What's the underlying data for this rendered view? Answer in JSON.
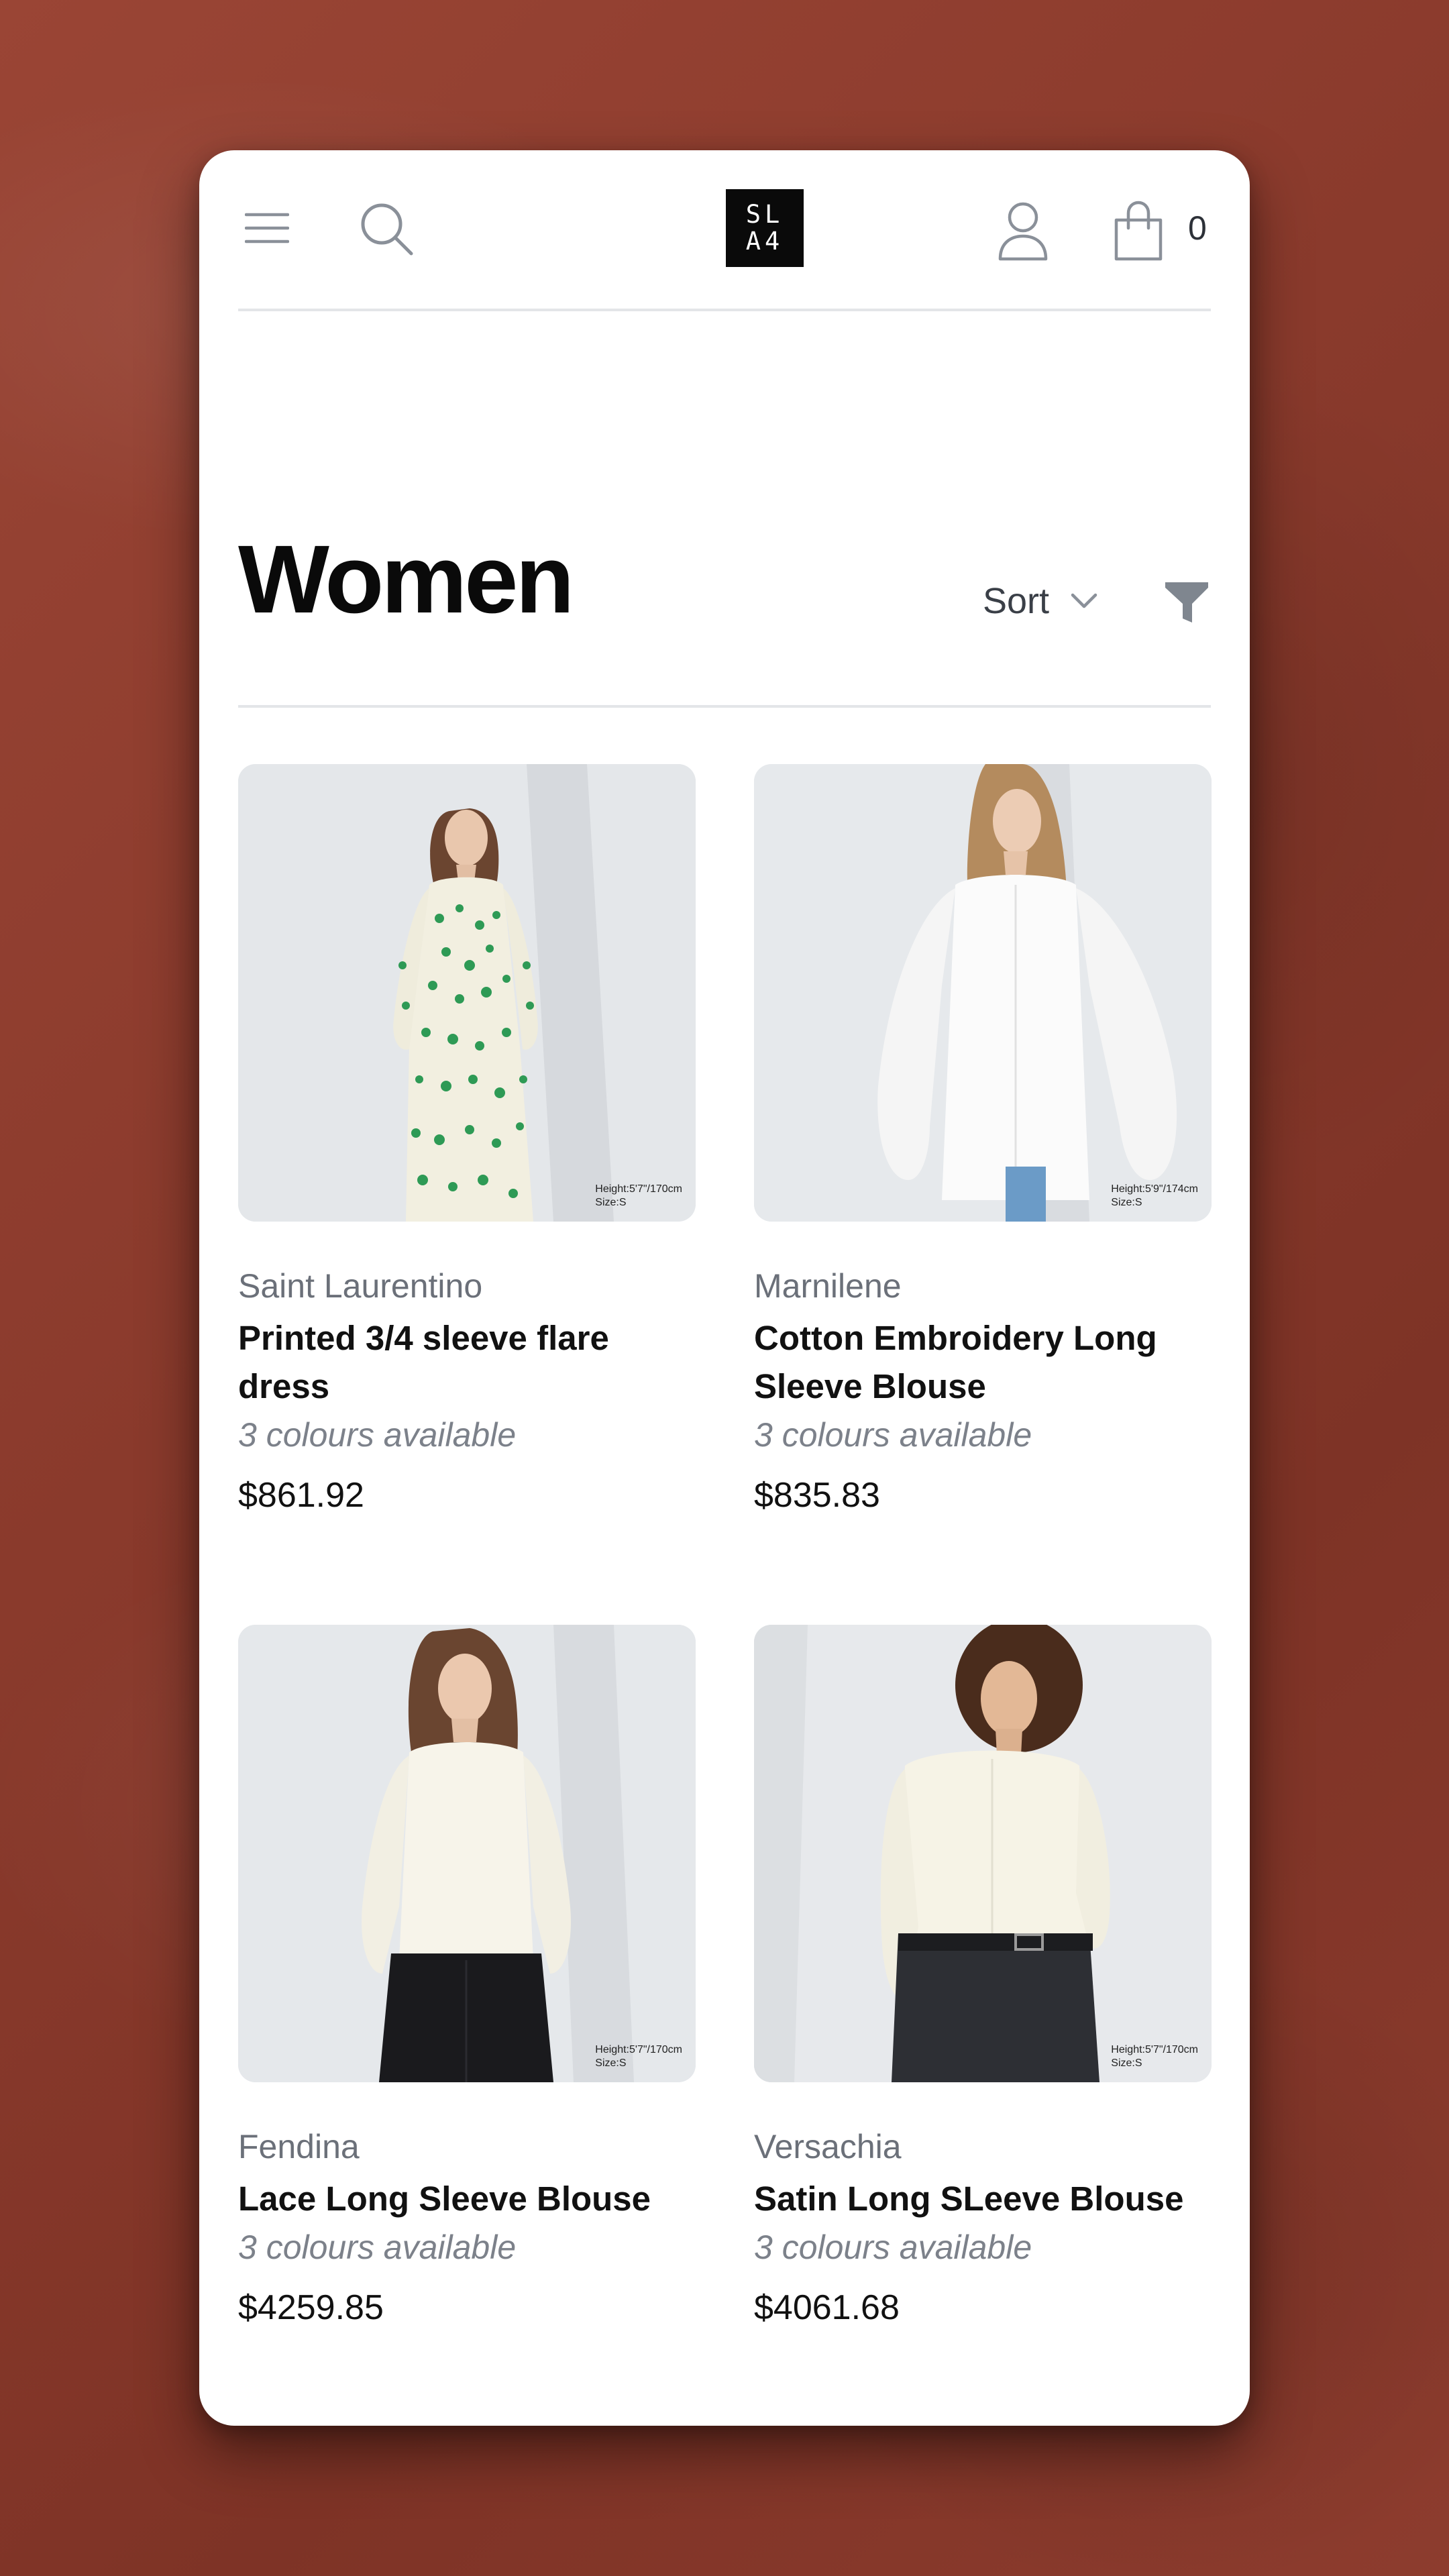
{
  "header": {
    "logo_text": "SL\nA4",
    "cart_count": "0",
    "icons": [
      "menu-icon",
      "search-icon",
      "user-icon",
      "shopping-bag-icon"
    ]
  },
  "page": {
    "title": "Women",
    "sort_label": "Sort",
    "icons": [
      "chevron-down-icon",
      "filter-icon"
    ]
  },
  "products": [
    {
      "brand": "Saint Laurentino",
      "name": "Printed 3/4 sleeve flare dress",
      "colours": "3 colours available",
      "price": "$861.92",
      "size_note_1": "Height:5'7\"/170cm",
      "size_note_2": "Size:S"
    },
    {
      "brand": "Marnilene",
      "name": "Cotton Embroidery Long Sleeve Blouse",
      "colours": "3 colours available",
      "price": "$835.83",
      "size_note_1": "Height:5'9\"/174cm",
      "size_note_2": "Size:S"
    },
    {
      "brand": "Fendina",
      "name": "Lace Long Sleeve Blouse",
      "colours": "3 colours available",
      "price": "$4259.85",
      "size_note_1": "Height:5'7\"/170cm",
      "size_note_2": "Size:S"
    },
    {
      "brand": "Versachia",
      "name": "Satin Long SLeeve Blouse",
      "colours": "3 colours available",
      "price": "$4061.68",
      "size_note_1": "Height:5'7\"/170cm",
      "size_note_2": "Size:S"
    }
  ],
  "colors": {
    "background": "#8a3a2c",
    "card": "#ffffff",
    "title": "#0a0a0a",
    "brand_text": "#6b7079",
    "muted_italic": "#7c818a",
    "icon_stroke": "#8a9099",
    "divider": "#e3e5e8"
  }
}
